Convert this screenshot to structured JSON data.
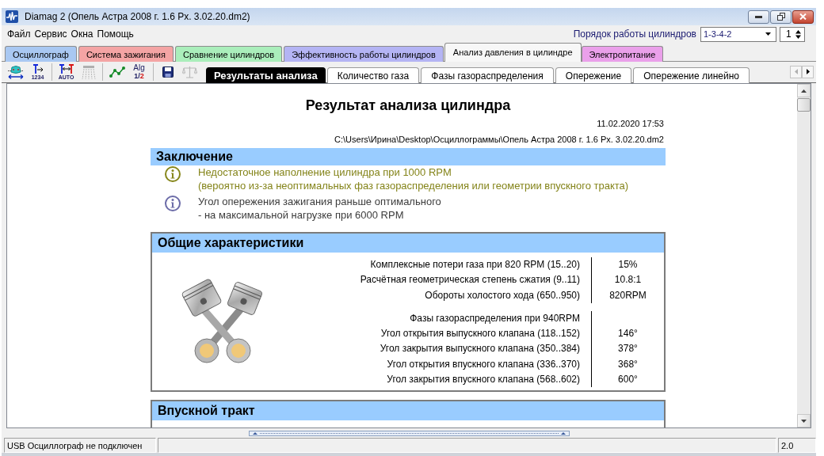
{
  "window": {
    "title": "Diamag 2 (Опель Астра 2008 г. 1.6 Px. 3.02.20.dm2)"
  },
  "menu": [
    {
      "label": "Файл"
    },
    {
      "label": "Сервис"
    },
    {
      "label": "Окна"
    },
    {
      "label": "Помощь"
    }
  ],
  "cylinder_order": {
    "label": "Порядок работы цилиндров",
    "value": "1-3-4-2",
    "cylinder": "1"
  },
  "tabs": [
    {
      "label": "Осциллограф",
      "selected": false,
      "color": "#a9c8f2"
    },
    {
      "label": "Система зажигания",
      "selected": false,
      "color": "#f4a4a4"
    },
    {
      "label": "Сравнение цилиндров",
      "selected": false,
      "color": "#aaeebb"
    },
    {
      "label": "Эффективность работы цилиндров",
      "selected": false,
      "color": "#b4b4f4"
    },
    {
      "label": "Анализ давления в цилиндре",
      "selected": true,
      "color": "#f7f7f7"
    },
    {
      "label": "Электропитание",
      "selected": false,
      "color": "#eaa0ea"
    }
  ],
  "toolbar": {
    "groups": [
      [
        {
          "kind": "probe",
          "disabled": false
        },
        {
          "kind": "marker",
          "label": "1234",
          "disabled": false
        }
      ],
      [
        {
          "kind": "auto-markers",
          "label": "AUTO",
          "disabled": false
        },
        {
          "kind": "comb",
          "disabled": true
        }
      ],
      [
        {
          "kind": "graph",
          "disabled": false
        },
        {
          "kind": "algorithm",
          "label": "Alg",
          "sublabel": "1/2",
          "disabled": false
        }
      ],
      [
        {
          "kind": "save",
          "disabled": false
        },
        {
          "kind": "scales",
          "disabled": true
        }
      ]
    ]
  },
  "subtabs": [
    {
      "label": "Результаты анализа",
      "selected": true
    },
    {
      "label": "Количество газа",
      "selected": false
    },
    {
      "label": "Фазы газораспределения",
      "selected": false
    },
    {
      "label": "Опережение",
      "selected": false
    },
    {
      "label": "Опережение линейно",
      "selected": false
    }
  ],
  "subtab_scroll": {
    "back_disabled": true,
    "forward_disabled": false
  },
  "report": {
    "title": "Результат анализа цилиндра",
    "date": "11.02.2020 17:53",
    "path": "C:\\Users\\Ирина\\Desktop\\Осциллограммы\\Опель Астра 2008 г. 1.6 Px. 3.02.20.dm2",
    "sections": [
      {
        "kind": "findings",
        "heading": "Заключение",
        "items": [
          {
            "kind": "warning",
            "lines": [
              "Недостаточное наполнение цилиндра при 1000 RPM",
              "(вероятно из-за неоптимальных фаз газораспределения или геометрии впускного тракта)"
            ]
          },
          {
            "kind": "info",
            "lines": [
              "Угол опережения зажигания раньше оптимального",
              "- на максимальной нагрузке при 6000 RPM"
            ]
          }
        ]
      },
      {
        "kind": "table",
        "heading": "Общие характеристики",
        "groups": [
          [
            {
              "label": "Комплексные потери газа при 820 RPM (15..20)",
              "value": "15%"
            },
            {
              "label": "Расчётная геометрическая степень сжатия (9..11)",
              "value": "10.8:1"
            },
            {
              "label": "Обороты холостого хода (650..950)",
              "value": "820RPM"
            }
          ],
          [
            {
              "label": "Фазы газораспределения при 940RPM"
            },
            {
              "label": "Угол открытия выпускного клапана (118..152)",
              "value": "146°"
            },
            {
              "label": "Угол закрытия выпускного клапана (350..384)",
              "value": "378°"
            },
            {
              "label": "Угол открытия впускного клапана (336..370)",
              "value": "368°"
            },
            {
              "label": "Угол закрытия впускного клапана (568..602)",
              "value": "600°"
            }
          ]
        ]
      },
      {
        "kind": "table",
        "heading": "Впускной тракт"
      }
    ]
  },
  "status_bar": {
    "connection": "USB Осциллограф не подключен",
    "version": "2.0"
  }
}
